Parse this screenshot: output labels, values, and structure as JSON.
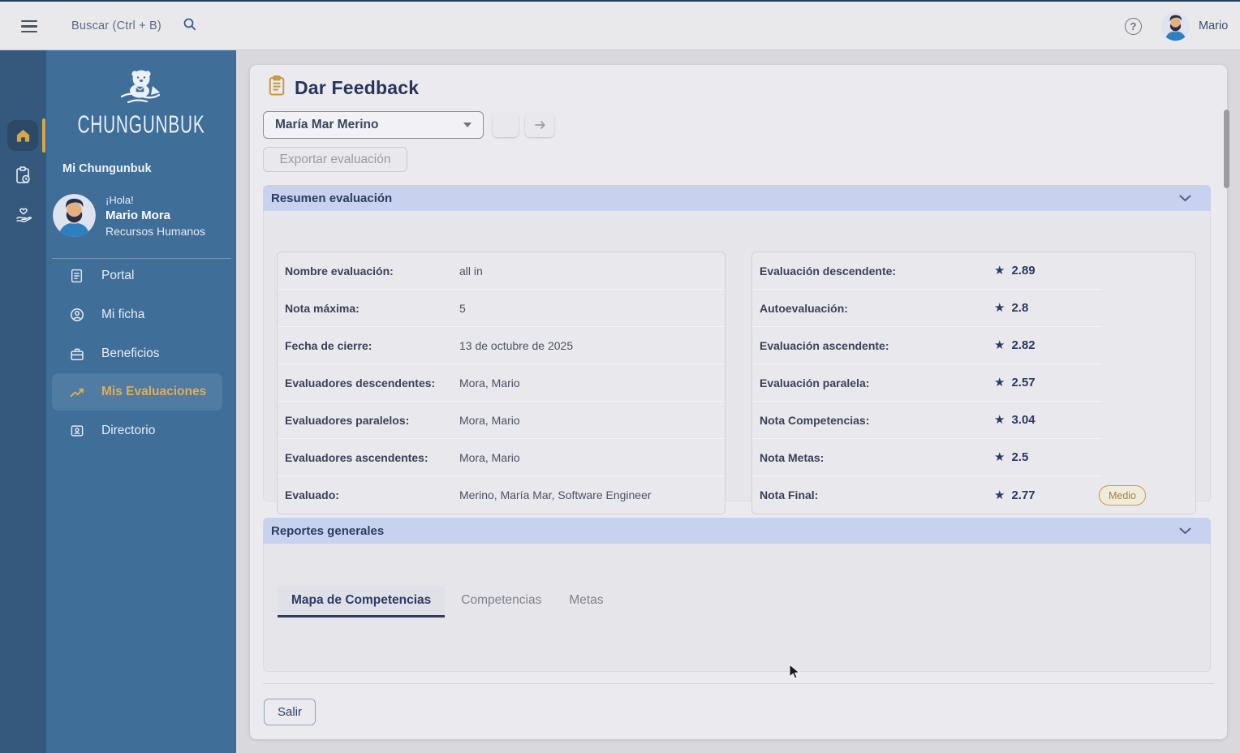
{
  "topbar": {
    "search_placeholder": "Buscar (Ctrl + B)",
    "user_name": "Mario"
  },
  "rail": {
    "items": [
      {
        "icon": "home-icon",
        "active": true
      },
      {
        "icon": "clipboard-clock-icon",
        "active": false
      },
      {
        "icon": "hand-heart-icon",
        "active": false
      }
    ]
  },
  "sidebar": {
    "brand": "CHUNGUNBUK",
    "section_label": "Mi Chungunbuk",
    "profile": {
      "greeting": "¡Hola!",
      "name": "Mario Mora",
      "role": "Recursos Humanos"
    },
    "items": [
      {
        "label": "Portal",
        "icon": "document-icon",
        "active": false
      },
      {
        "label": "Mi ficha",
        "icon": "user-circle-icon",
        "active": false
      },
      {
        "label": "Beneficios",
        "icon": "briefcase-icon",
        "active": false
      },
      {
        "label": "Mis Evaluaciones",
        "icon": "trending-up-icon",
        "active": true
      },
      {
        "label": "Directorio",
        "icon": "id-card-icon",
        "active": false
      }
    ]
  },
  "main": {
    "title": "Dar Feedback",
    "person_select": {
      "value": "María Mar Merino"
    },
    "export_button_label": "Exportar evaluación",
    "summary_panel": {
      "title": "Resumen evaluación",
      "details": [
        {
          "label": "Nombre evaluación:",
          "value": "all in"
        },
        {
          "label": "Nota máxima:",
          "value": "5"
        },
        {
          "label": "Fecha de cierre:",
          "value": "13 de octubre de 2025"
        },
        {
          "label": "Evaluadores descendentes:",
          "value": "Mora, Mario"
        },
        {
          "label": "Evaluadores paralelos:",
          "value": "Mora, Mario"
        },
        {
          "label": "Evaluadores ascendentes:",
          "value": "Mora, Mario"
        },
        {
          "label": "Evaluado:",
          "value": "Merino, María Mar, Software Engineer"
        }
      ],
      "scores": [
        {
          "label": "Evaluación descendente:",
          "value": "2.89"
        },
        {
          "label": "Autoevaluación:",
          "value": "2.8"
        },
        {
          "label": "Evaluación ascendente:",
          "value": "2.82"
        },
        {
          "label": "Evaluación paralela:",
          "value": "2.57"
        },
        {
          "label": "Nota Competencias:",
          "value": "3.04"
        },
        {
          "label": "Nota Metas:",
          "value": "2.5"
        },
        {
          "label": "Nota Final:",
          "value": "2.77"
        }
      ],
      "final_badge": "Medio"
    },
    "reports_panel": {
      "title": "Reportes generales",
      "tabs": [
        {
          "label": "Mapa de Competencias",
          "active": true
        },
        {
          "label": "Competencias",
          "active": false
        },
        {
          "label": "Metas",
          "active": false
        }
      ]
    },
    "exit_button_label": "Salir"
  },
  "colors": {
    "accent_gold": "#d8a64a",
    "navy_text": "#2c3c63",
    "rail_blue": "#35597c",
    "sidebar_blue": "#3f6e99",
    "panel_header": "#c8d2ee",
    "badge_border": "#c09d4c",
    "badge_text": "#a5833c",
    "star_color": "#2b3a62"
  }
}
